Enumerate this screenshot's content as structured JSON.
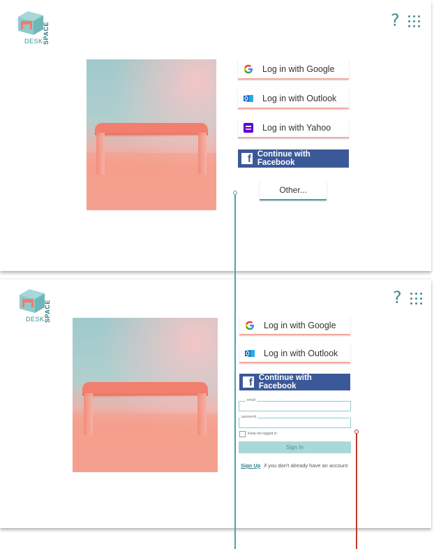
{
  "colors": {
    "brand_teal": "#3d8d91",
    "facebook_blue": "#3b5998",
    "accent_coral": "#f4a99e",
    "connector_teal": "#4aa3a6",
    "connector_red": "#c0392b"
  },
  "logo": {
    "word1": "DESK",
    "word2": "SPACE"
  },
  "header_icons": {
    "help": "?",
    "apps": "grid-icon"
  },
  "screen_top": {
    "buttons": [
      {
        "label": "Log in with Google",
        "icon": "google-icon"
      },
      {
        "label": "Log in with Outlook",
        "icon": "outlook-icon"
      },
      {
        "label": "Log in with Yahoo",
        "icon": "yahoo-icon"
      }
    ],
    "facebook_label": "Continue with Facebook",
    "other_label": "Other..."
  },
  "screen_bottom": {
    "buttons": [
      {
        "label": "Log in with Google",
        "icon": "google-icon"
      },
      {
        "label": "Log in with Outlook",
        "icon": "outlook-icon"
      }
    ],
    "facebook_label": "Continue with Facebook",
    "email_label": "email",
    "password_label": "password",
    "keep_logged_in": "Keep me logged in",
    "sign_in_label": "Sign In",
    "signup_link": "Sign Up",
    "signup_text": "if you don't already have an account"
  }
}
